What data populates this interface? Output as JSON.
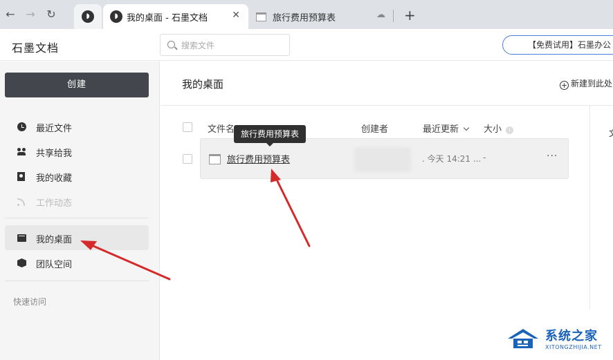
{
  "browser": {
    "tabs": [
      {
        "title": "我的桌面 - 石墨文档",
        "active": true
      },
      {
        "title": "旅行费用预算表",
        "active": false
      }
    ],
    "close_glyph": "✕",
    "new_tab_glyph": "+",
    "back_glyph": "←",
    "forward_glyph": "→",
    "reload_glyph": "↻",
    "cloud_glyph": "☁"
  },
  "header": {
    "brand": "石墨文档",
    "search": {
      "placeholder": "搜索文件"
    },
    "trial_button": "【免费试用】石墨办公"
  },
  "sidebar": {
    "create_button": "创建",
    "items": [
      {
        "label": "最近文件",
        "icon": "clock-icon"
      },
      {
        "label": "共享给我",
        "icon": "users-icon"
      },
      {
        "label": "我的收藏",
        "icon": "bookmark-icon"
      },
      {
        "label": "工作动态",
        "icon": "rss-icon",
        "disabled": true
      },
      {
        "label": "我的桌面",
        "icon": "desktop-icon",
        "active": true
      },
      {
        "label": "团队空间",
        "icon": "box-icon"
      }
    ],
    "quick_access": "快速访问"
  },
  "main": {
    "title": "我的桌面",
    "new_here": "新建到此处",
    "right_fragment": "文",
    "columns": {
      "name": "文件名",
      "creator": "创建者",
      "updated": "最近更新",
      "size": "大小"
    },
    "files": [
      {
        "name": "旅行费用预算表",
        "creator": "",
        "updated": "今天 14:21 ...",
        "size": "-",
        "dot": "."
      }
    ],
    "tooltip": "旅行费用预算表",
    "more_glyph": "···"
  },
  "watermark": {
    "title": "系统之家",
    "subtitle": "XITONGZHIJIA.NET"
  },
  "colors": {
    "annotation_arrow": "#d42a2a",
    "watermark": "#1b63b8",
    "create_button": "#43474d"
  }
}
